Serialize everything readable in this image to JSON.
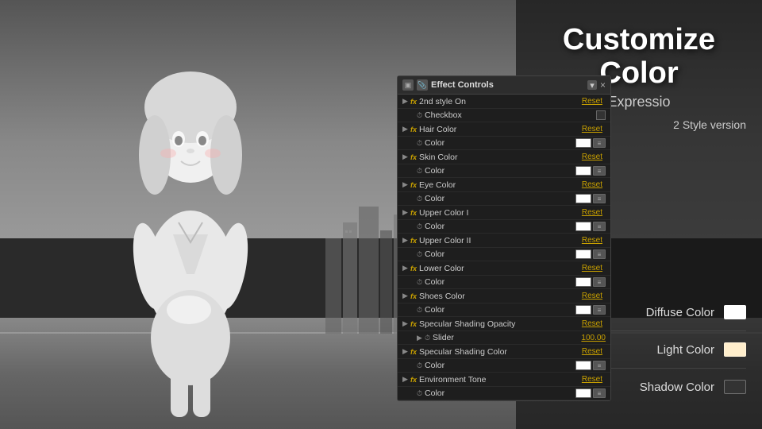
{
  "page": {
    "title": "Customize Color",
    "subtitle": "Expressio",
    "style_version": "2 Style version"
  },
  "right_labels": [
    {
      "id": "diffuse",
      "text": "Diffuse Color",
      "swatch": "#ffffff"
    },
    {
      "id": "light",
      "text": "Light Color",
      "swatch": "#ffeecc"
    },
    {
      "id": "shadow",
      "text": "Shadow Color",
      "swatch": "#333333"
    }
  ],
  "panel": {
    "title": "Effect Controls",
    "close_icon": "×",
    "icon1": "▣",
    "icon2": "📎"
  },
  "fx_rows": [
    {
      "id": "2nd_style",
      "label": "2nd style On",
      "type": "main",
      "expandable": true
    },
    {
      "id": "2nd_style_cb",
      "label": "Checkbox",
      "type": "sub_checkbox"
    },
    {
      "id": "hair_color",
      "label": "Hair Color",
      "type": "main",
      "expandable": true
    },
    {
      "id": "hair_color_sub",
      "label": "Color",
      "type": "sub_color"
    },
    {
      "id": "skin_color",
      "label": "Skin Color",
      "type": "main",
      "expandable": true
    },
    {
      "id": "skin_color_sub",
      "label": "Color",
      "type": "sub_color"
    },
    {
      "id": "eye_color",
      "label": "Eye Color",
      "type": "main",
      "expandable": true
    },
    {
      "id": "eye_color_sub",
      "label": "Color",
      "type": "sub_color"
    },
    {
      "id": "upper_color1",
      "label": "Upper Color I",
      "type": "main",
      "expandable": true
    },
    {
      "id": "upper_color1_sub",
      "label": "Color",
      "type": "sub_color"
    },
    {
      "id": "upper_color2",
      "label": "Upper Color II",
      "type": "main",
      "expandable": true
    },
    {
      "id": "upper_color2_sub",
      "label": "Color",
      "type": "sub_color"
    },
    {
      "id": "lower_color",
      "label": "Lower Color",
      "type": "main",
      "expandable": true
    },
    {
      "id": "lower_color_sub",
      "label": "Color",
      "type": "sub_color"
    },
    {
      "id": "shoes_color",
      "label": "Shoes Color",
      "type": "main",
      "expandable": true
    },
    {
      "id": "shoes_color_sub",
      "label": "Color",
      "type": "sub_color"
    },
    {
      "id": "spec_opacity",
      "label": "Specular Shading Opacity",
      "type": "main",
      "expandable": true
    },
    {
      "id": "spec_opacity_slider",
      "label": "Slider",
      "type": "sub_slider",
      "value": "100.00",
      "fill_pct": 100
    },
    {
      "id": "spec_color",
      "label": "Specular Shading Color",
      "type": "main",
      "expandable": true
    },
    {
      "id": "spec_color_sub",
      "label": "Color",
      "type": "sub_color"
    },
    {
      "id": "env_tone",
      "label": "Environment Tone",
      "type": "main",
      "expandable": true
    },
    {
      "id": "env_tone_sub",
      "label": "Color",
      "type": "sub_color"
    }
  ],
  "reset_label": "Reset"
}
